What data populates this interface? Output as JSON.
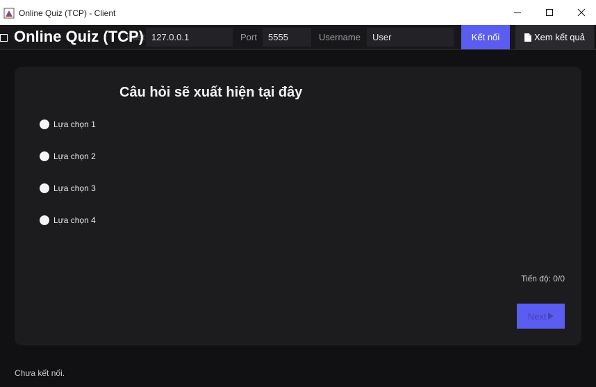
{
  "window": {
    "title": "Online Quiz (TCP) - Client",
    "icons": {
      "minimize": "minimize-icon",
      "maximize": "maximize-icon",
      "close": "close-icon"
    }
  },
  "toolbar": {
    "heading": "Online Quiz (TCP)",
    "host_label": "Host",
    "host_value": "127.0.0.1",
    "port_label": "Port",
    "port_value": "5555",
    "username_label": "Username",
    "username_value": "User",
    "connect_label": "Kết nối",
    "results_label": "Xem kết quả",
    "results_icon": "document-icon"
  },
  "quiz": {
    "question": "Câu hỏi sẽ xuất hiện tại đây",
    "options": [
      {
        "label": "Lựa chọn 1"
      },
      {
        "label": "Lựa chọn 2"
      },
      {
        "label": "Lựa chọn 3"
      },
      {
        "label": "Lựa chọn 4"
      }
    ],
    "progress": "Tiến độ: 0/0",
    "next_label": "Next"
  },
  "status": {
    "text": "Chưa kết nối."
  },
  "colors": {
    "accent": "#5b5df0",
    "background": "#111113",
    "card": "#1c1c1f",
    "toolbar": "#18181b",
    "input": "#232327"
  }
}
